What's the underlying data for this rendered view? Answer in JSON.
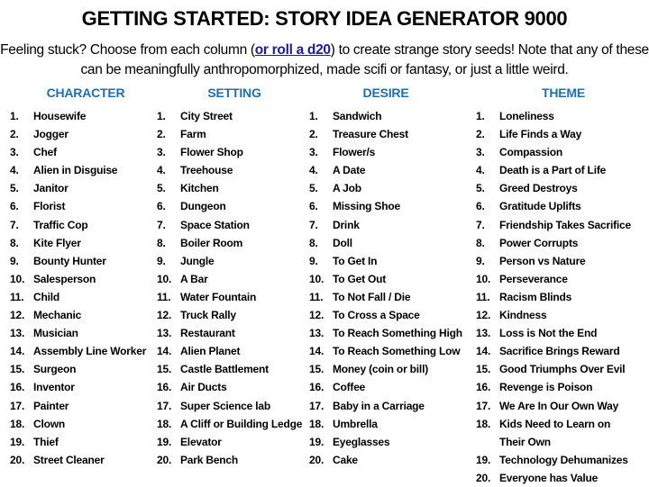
{
  "title": "GETTING STARTED: STORY IDEA GENERATOR 9000",
  "intro": {
    "before_link": "Feeling stuck? Choose from each column (",
    "link_text": "or roll a d20",
    "after_link": ") to create strange story seeds! Note that any of these can be meaningfully anthropomorphized, made scifi or fantasy, or just a little weird."
  },
  "colors": {
    "header": "#1f6fb0",
    "link": "#1a1aa6"
  },
  "columns": {
    "character": {
      "header": "CHARACTER",
      "items": [
        "Housewife",
        "Jogger",
        "Chef",
        "Alien in Disguise",
        "Janitor",
        "Florist",
        "Traffic Cop",
        "Kite Flyer",
        "Bounty Hunter",
        "Salesperson",
        "Child",
        "Mechanic",
        "Musician",
        "Assembly Line Worker",
        "Surgeon",
        "Inventor",
        "Painter",
        "Clown",
        "Thief",
        "Street Cleaner"
      ]
    },
    "setting": {
      "header": "SETTING",
      "items": [
        "City Street",
        "Farm",
        "Flower Shop",
        "Treehouse",
        "Kitchen",
        "Dungeon",
        "Space Station",
        "Boiler Room",
        "Jungle",
        "A Bar",
        "Water Fountain",
        "Truck Rally",
        "Restaurant",
        "Alien Planet",
        "Castle Battlement",
        "Air Ducts",
        "Super Science lab",
        "A Cliff or Building Ledge",
        "Elevator",
        "Park Bench"
      ]
    },
    "desire": {
      "header": "DESIRE",
      "items": [
        "Sandwich",
        "Treasure Chest",
        "Flower/s",
        "A Date",
        "A Job",
        "Missing Shoe",
        "Drink",
        "Doll",
        "To Get In",
        "To Get Out",
        "To Not Fall / Die",
        "To Cross a Space",
        "To Reach Something High",
        "To Reach Something Low",
        "Money (coin or bill)",
        "Coffee",
        "Baby in a Carriage",
        "Umbrella",
        "Eyeglasses",
        "Cake"
      ]
    },
    "theme": {
      "header": "THEME",
      "items": [
        "Loneliness",
        "Life Finds a Way",
        "Compassion",
        "Death is a Part of Life",
        "Greed Destroys",
        "Gratitude Uplifts",
        "Friendship Takes Sacrifice",
        "Power Corrupts",
        "Person vs Nature",
        "Perseverance",
        "Racism Blinds",
        "Kindness",
        "Loss is Not the End",
        "Sacrifice Brings Reward",
        "Good Triumphs Over Evil",
        "Revenge is Poison",
        "We Are In Our Own Way",
        "Kids Need to Learn on Their Own",
        "Technology Dehumanizes",
        "Everyone has Value"
      ]
    }
  }
}
